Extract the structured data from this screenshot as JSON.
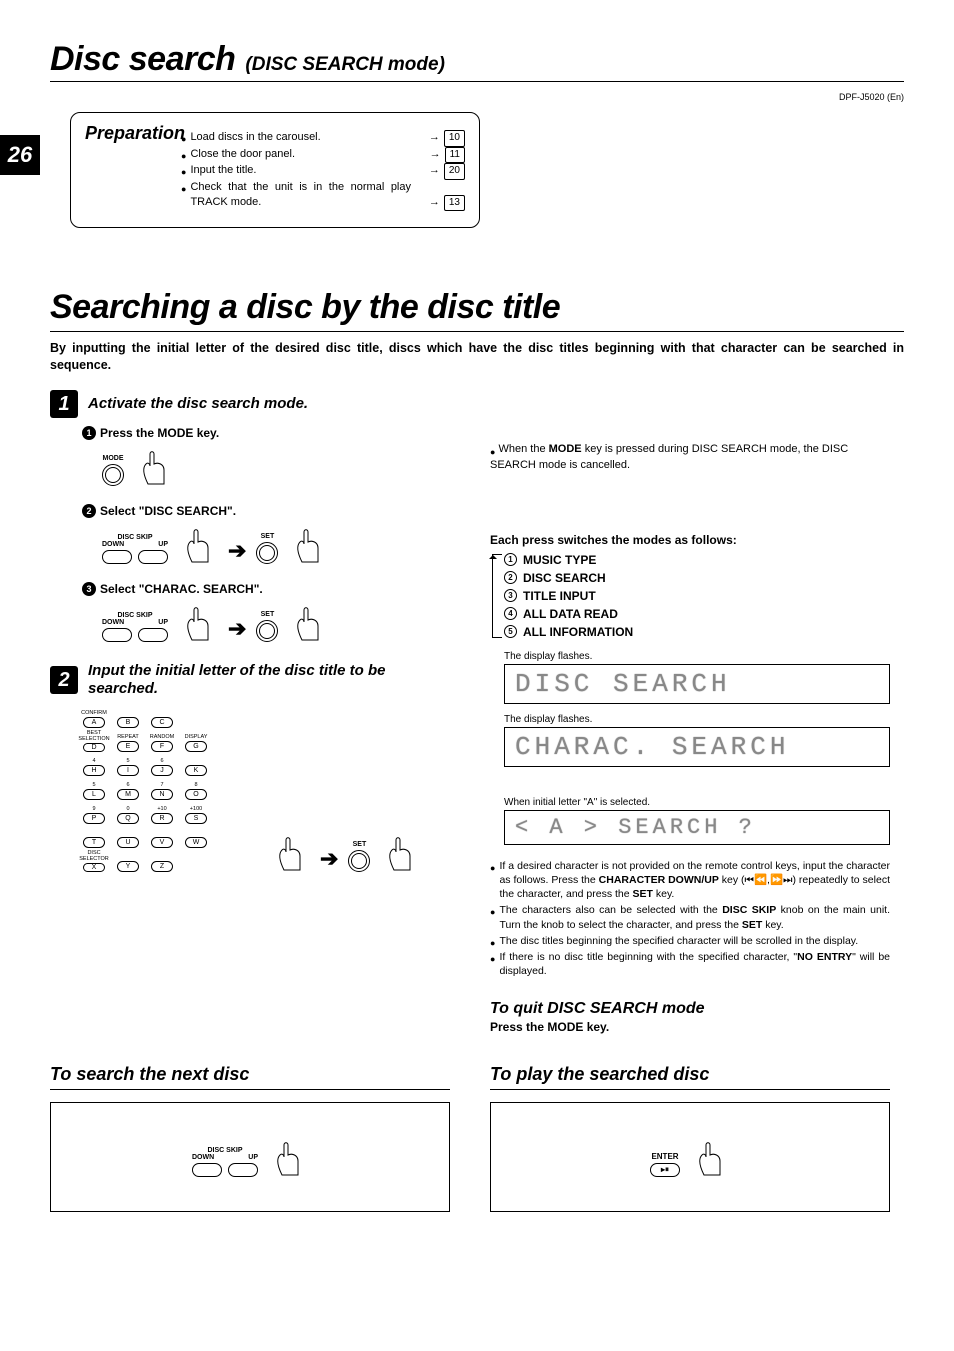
{
  "header": {
    "title": "Disc search",
    "mode": "(DISC SEARCH mode)",
    "model": "DPF-J5020 (En)",
    "page_number": "26"
  },
  "preparation": {
    "title": "Preparation",
    "items": [
      {
        "text": "Load discs in the carousel.",
        "ref": "10"
      },
      {
        "text": "Close the door panel.",
        "ref": "11"
      },
      {
        "text": "Input the title.",
        "ref": "20"
      },
      {
        "text": "Check that the unit is in the normal play TRACK mode.",
        "ref": "13"
      }
    ]
  },
  "section2": {
    "title": "Searching a disc by the disc title",
    "intro": "By inputting the initial letter of the desired disc title, discs which have the disc titles beginning with that character can be searched in sequence."
  },
  "step1": {
    "label": "Activate the disc search mode.",
    "sub": [
      {
        "n": "1",
        "text": "Press the MODE key.",
        "art_label": "MODE"
      },
      {
        "n": "2",
        "text": "Select \"DISC SEARCH\".",
        "group_label": "DISC SKIP",
        "down": "DOWN",
        "up": "UP",
        "set": "SET"
      },
      {
        "n": "3",
        "text": "Select \"CHARAC. SEARCH\".",
        "group_label": "DISC SKIP",
        "down": "DOWN",
        "up": "UP",
        "set": "SET"
      }
    ]
  },
  "step2": {
    "label": "Input the initial letter of the disc title to be searched.",
    "set": "SET",
    "keys": [
      [
        "CONFIRM",
        "",
        "",
        ""
      ],
      [
        "A",
        "B",
        "C",
        ""
      ],
      [
        "BEST SELECTION",
        "REPEAT",
        "RANDOM",
        "DISPLAY"
      ],
      [
        "D",
        "E",
        "F",
        "G"
      ],
      [
        "4",
        "5",
        "6",
        ""
      ],
      [
        "H",
        "I",
        "J",
        "K"
      ],
      [
        "5",
        "6",
        "7",
        "8"
      ],
      [
        "L",
        "M",
        "N",
        "O"
      ],
      [
        "9",
        "0",
        "+10",
        "+100"
      ],
      [
        "P",
        "Q",
        "R",
        "S"
      ],
      [
        "",
        "",
        "",
        ""
      ],
      [
        "T",
        "U",
        "V",
        "W"
      ],
      [
        "DISC SELECTOR",
        "",
        "",
        ""
      ],
      [
        "X",
        "Y",
        "Z",
        ""
      ]
    ]
  },
  "right": {
    "mode_note_pre": "When the ",
    "mode_key": "MODE",
    "mode_note_post": " key is pressed during DISC SEARCH mode, the DISC SEARCH mode is cancelled.",
    "modes_title": "Each press switches the modes as follows:",
    "modes": [
      {
        "n": "1",
        "label": "MUSIC TYPE"
      },
      {
        "n": "2",
        "label": "DISC SEARCH"
      },
      {
        "n": "3",
        "label": "TITLE INPUT"
      },
      {
        "n": "4",
        "label": "ALL DATA READ"
      },
      {
        "n": "5",
        "label": "ALL INFORMATION"
      }
    ],
    "flash1": "The display flashes.",
    "lcd1": "DISC SEARCH",
    "flash2": "The display flashes.",
    "lcd2": "CHARAC. SEARCH",
    "initial_label": "When initial letter \"A\" is selected.",
    "lcd3": "< A > SEARCH ?",
    "tips": [
      {
        "pre": "If a desired character is not provided on the remote control keys, input the character as follows. Press the ",
        "b1": "CHARACTER DOWN/UP",
        "mid": " key (⏮⏪,⏩⏭) repeatedly to select the character, and press the ",
        "b2": "SET",
        "post": " key."
      },
      {
        "pre": "The characters also can be selected with the ",
        "b1": "DISC SKIP",
        "mid": " knob on the main unit. Turn the knob to select the character, and press the ",
        "b2": "SET",
        "post": " key."
      },
      {
        "pre": "The disc titles beginning the specified character will be scrolled in the display.",
        "b1": "",
        "mid": "",
        "b2": "",
        "post": ""
      },
      {
        "pre": "If there is no disc title beginning with the specified character, \"",
        "b1": "NO ENTRY",
        "mid": "\" will be displayed.",
        "b2": "",
        "post": ""
      }
    ],
    "quit_title": "To quit DISC SEARCH mode",
    "quit_body": "Press the MODE key."
  },
  "bottom": {
    "left": {
      "title": "To search the next disc",
      "group_label": "DISC SKIP",
      "down": "DOWN",
      "up": "UP"
    },
    "right": {
      "title": "To play the searched disc",
      "enter": "ENTER",
      "glyph": "▸⏸"
    }
  }
}
